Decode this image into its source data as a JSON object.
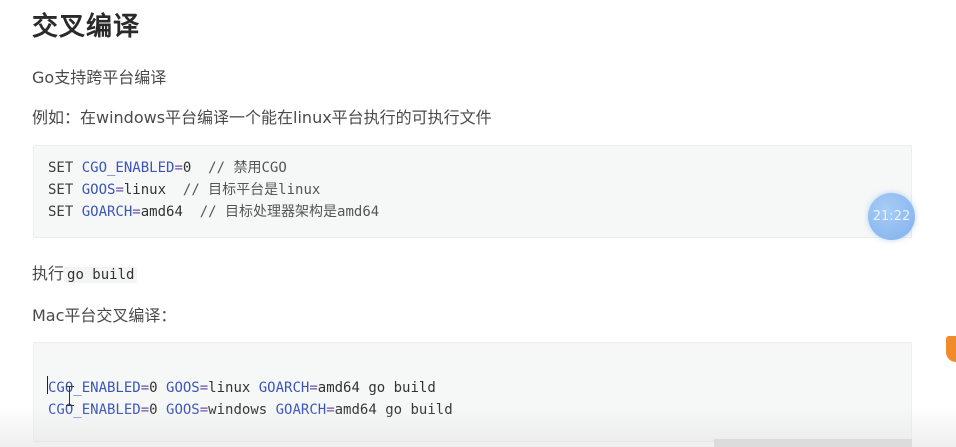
{
  "heading": "交叉编译",
  "para1": "Go支持跨平台编译",
  "para2": "例如：在windows平台编译一个能在linux平台执行的可执行文件",
  "block1": {
    "lines": [
      {
        "kw": "SET ",
        "var": "CGO_ENABLED",
        "eq": "=",
        "val": "0",
        "comment": "  // 禁用CGO"
      },
      {
        "kw": "SET ",
        "var": "GOOS",
        "eq": "=",
        "val": "linux",
        "comment": "  // 目标平台是linux"
      },
      {
        "kw": "SET ",
        "var": "GOARCH",
        "eq": "=",
        "val": "amd64",
        "comment": "  // 目标处理器架构是amd64"
      }
    ]
  },
  "para3_prefix": "执行",
  "para3_code": "go build",
  "para4": "Mac平台交叉编译：",
  "block2": {
    "line1": {
      "v1": "CGO_ENABLED",
      "e1": "=",
      "x1": "0 ",
      "v2": "GOOS",
      "e2": "=",
      "x2": "linux ",
      "v3": "GOARCH",
      "e3": "=",
      "x3": "amd64 go build"
    },
    "line2": {
      "v1": "CGO_ENABLED",
      "e1": "=",
      "x1": "0 ",
      "v2": "GOOS",
      "e2": "=",
      "x2": "windows ",
      "v3": "GOARCH",
      "e3": "=",
      "x3": "amd64 go build"
    }
  },
  "timer": "21:22",
  "colors": {
    "variable": "#3b55b8",
    "operator": "#6c4fa6",
    "badge": "#7fb1ee",
    "edge_accent": "#f08a2a"
  }
}
